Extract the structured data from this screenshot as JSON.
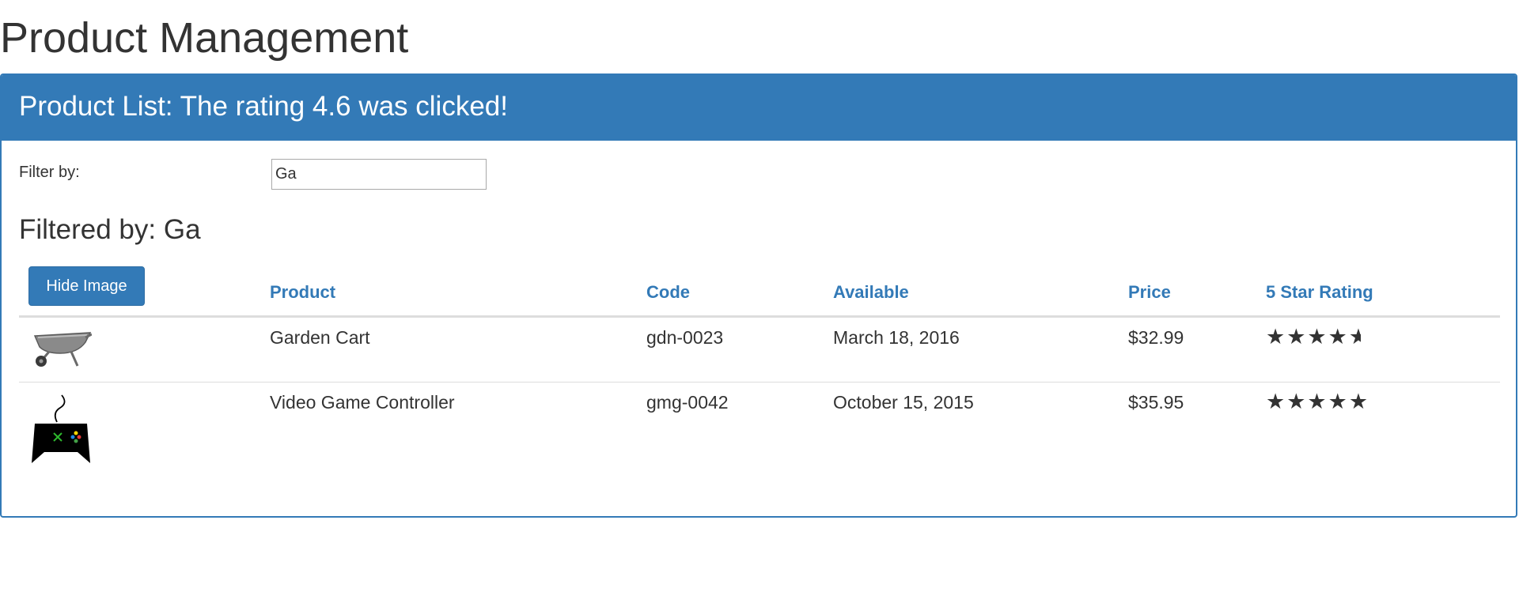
{
  "page": {
    "title": "Product Management"
  },
  "panel": {
    "heading": "Product List: The rating 4.6 was clicked!"
  },
  "filter": {
    "label": "Filter by:",
    "value": "Ga",
    "filtered_heading": "Filtered by: Ga"
  },
  "table": {
    "hide_image_label": "Hide Image",
    "columns": [
      "Product",
      "Code",
      "Available",
      "Price",
      "5 Star Rating"
    ],
    "rows": [
      {
        "image_icon": "wheelbarrow-icon",
        "product": "Garden Cart",
        "code": "gdn-0023",
        "available": "March 18, 2016",
        "price": "$32.99",
        "rating": 4.2
      },
      {
        "image_icon": "gamepad-icon",
        "product": "Video Game Controller",
        "code": "gmg-0042",
        "available": "October 15, 2015",
        "price": "$35.95",
        "rating": 4.6
      }
    ]
  },
  "colors": {
    "primary": "#337ab7",
    "text": "#333333",
    "rule": "#dddddd"
  }
}
